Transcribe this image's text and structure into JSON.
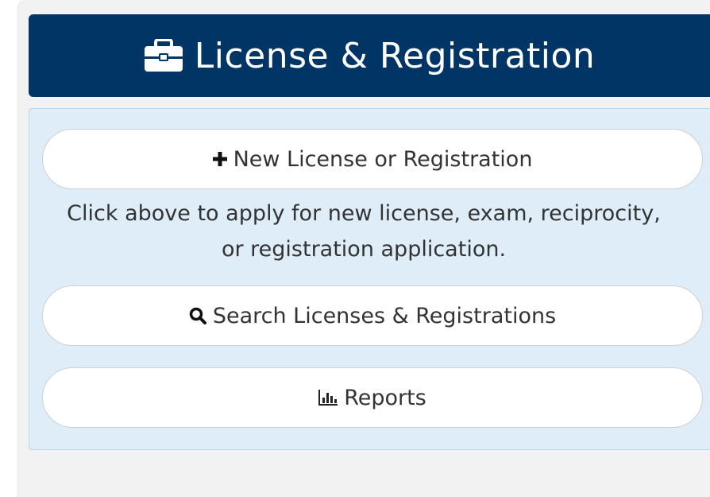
{
  "header": {
    "title": "License & Registration",
    "icon": "briefcase-icon",
    "background": "#003566"
  },
  "actions": {
    "new": {
      "label": "New License or Registration",
      "icon": "plus-icon"
    },
    "help_text": {
      "line1": "Click above to apply for new license, exam, reciprocity,",
      "line2": "or registration application."
    },
    "search": {
      "label": "Search Licenses & Registrations",
      "icon": "search-icon"
    },
    "reports": {
      "label": "Reports",
      "icon": "bar-chart-icon"
    }
  },
  "colors": {
    "panel_bg": "#deedf7",
    "panel_border": "#b8d5ea",
    "button_bg": "#ffffff",
    "text": "#333333"
  }
}
